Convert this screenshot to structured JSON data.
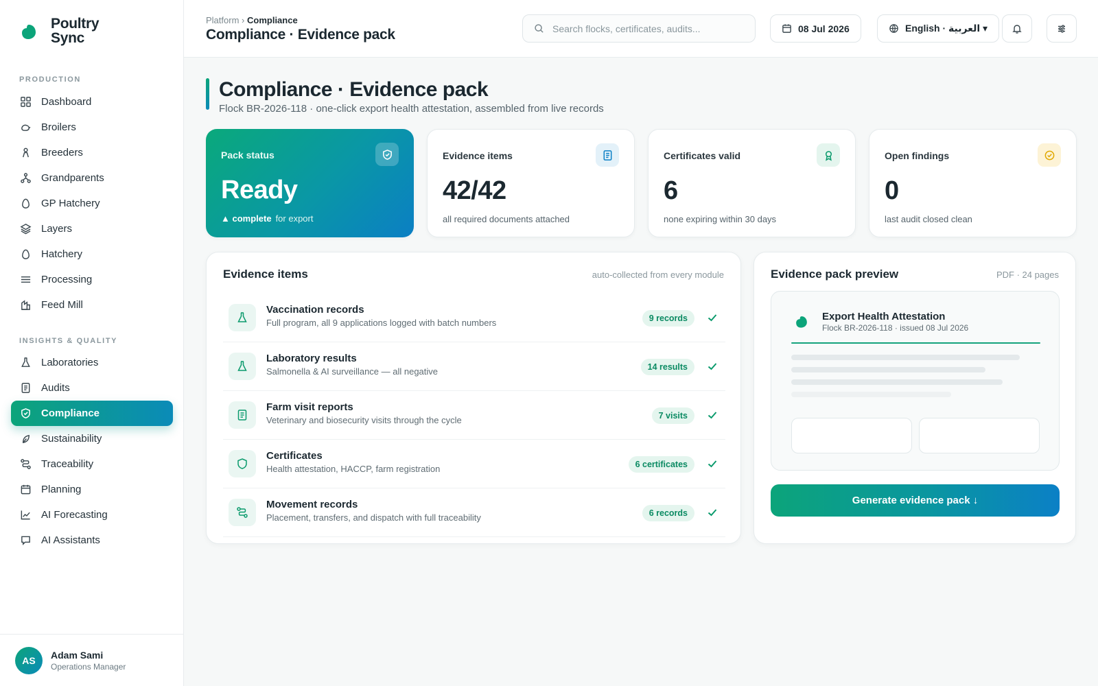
{
  "brand": {
    "name": "Poultry Sync",
    "accent": "#0ca47a",
    "accent2": "#0b8bb8"
  },
  "sidebar": {
    "sections": [
      {
        "title": "PRODUCTION",
        "items": [
          {
            "label": "Dashboard",
            "icon": "grid-icon"
          },
          {
            "label": "Broilers",
            "icon": "chick-icon"
          },
          {
            "label": "Breeders",
            "icon": "breeder-icon"
          },
          {
            "label": "Grandparents",
            "icon": "lineage-icon"
          },
          {
            "label": "GP Hatchery",
            "icon": "egg-icon"
          },
          {
            "label": "Layers",
            "icon": "layers-icon"
          },
          {
            "label": "Hatchery",
            "icon": "egg-icon"
          },
          {
            "label": "Processing",
            "icon": "lines-icon"
          },
          {
            "label": "Feed Mill",
            "icon": "mill-icon"
          }
        ]
      },
      {
        "title": "INSIGHTS & QUALITY",
        "items": [
          {
            "label": "Laboratories",
            "icon": "flask-icon"
          },
          {
            "label": "Audits",
            "icon": "document-icon"
          },
          {
            "label": "Compliance",
            "icon": "shield-icon",
            "active": true
          },
          {
            "label": "Sustainability",
            "icon": "leaf-icon"
          },
          {
            "label": "Traceability",
            "icon": "route-icon"
          },
          {
            "label": "Planning",
            "icon": "calendar-icon"
          },
          {
            "label": "AI Forecasting",
            "icon": "chart-icon"
          },
          {
            "label": "AI Assistants",
            "icon": "chat-icon"
          }
        ]
      }
    ]
  },
  "user": {
    "initials": "AS",
    "name": "Adam Sami",
    "role": "Operations Manager"
  },
  "topbar": {
    "breadcrumb_root": "Platform",
    "breadcrumb_sep": "›",
    "breadcrumb_current": "Compliance",
    "title": "Compliance · Evidence pack",
    "search_placeholder": "Search flocks, certificates, audits...",
    "date": "08 Jul 2026",
    "language": "English · العربية ▾"
  },
  "page": {
    "title": "Compliance · Evidence pack",
    "subtitle": "Flock BR-2026-118 · one-click export health attestation, assembled from live records"
  },
  "kpis": [
    {
      "label": "Pack status",
      "value": "Ready",
      "note_bold": "▲ complete",
      "note": "for export",
      "icon": "shield-check-icon"
    },
    {
      "label": "Evidence items",
      "value": "42/42",
      "note": "all required documents attached",
      "icon": "document-icon",
      "icon_bg": "#e3f1f9",
      "icon_color": "#0b80c6"
    },
    {
      "label": "Certificates valid",
      "value": "6",
      "note": "none expiring within 30 days",
      "icon": "award-icon",
      "icon_bg": "#e4f5ee",
      "icon_color": "#0a9a6c"
    },
    {
      "label": "Open findings",
      "value": "0",
      "note": "last audit closed clean",
      "icon": "check-circle-icon",
      "icon_bg": "#fdf3d6",
      "icon_color": "#e0a800"
    }
  ],
  "evidence": {
    "title": "Evidence items",
    "meta": "auto-collected from every module",
    "items": [
      {
        "title": "Vaccination records",
        "desc": "Full program, all 9 applications logged with batch numbers",
        "badge": "9 records",
        "icon": "flask-icon"
      },
      {
        "title": "Laboratory results",
        "desc": "Salmonella & AI surveillance — all negative",
        "badge": "14 results",
        "icon": "flask-icon"
      },
      {
        "title": "Farm visit reports",
        "desc": "Veterinary and biosecurity visits through the cycle",
        "badge": "7 visits",
        "icon": "document-icon"
      },
      {
        "title": "Certificates",
        "desc": "Health attestation, HACCP, farm registration",
        "badge": "6 certificates",
        "icon": "shield-icon"
      },
      {
        "title": "Movement records",
        "desc": "Placement, transfers, and dispatch with full traceability",
        "badge": "6 records",
        "icon": "route-icon"
      }
    ]
  },
  "preview": {
    "title": "Evidence pack preview",
    "meta": "PDF · 24 pages",
    "doc_title": "Export Health Attestation",
    "doc_sub": "Flock BR-2026-118 · issued 08 Jul 2026",
    "button": "Generate evidence pack ↓"
  }
}
